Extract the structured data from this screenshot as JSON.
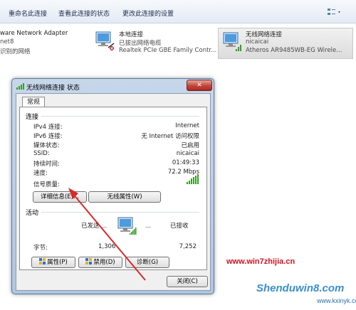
{
  "toolbar": {
    "rename": "重命名此连接",
    "view_status": "查看此连接的状态",
    "change_settings": "更改此连接的设置"
  },
  "adapters": [
    {
      "name": "ware Network Adapter",
      "status": "net8",
      "device": "识别的网络"
    },
    {
      "name": "本地连接",
      "status": "已拔出网络电缆",
      "device": "Realtek PCIe GBE Family Contr..."
    },
    {
      "name": "无线网络连接",
      "status": "nicaicai",
      "device": "Atheros AR9485WB-EG Wirele..."
    }
  ],
  "dialog": {
    "title": "无线网络连接 状态",
    "close_glyph": "✕",
    "tab": "常规",
    "connection_section": "连接",
    "rows": [
      {
        "label": "IPv4 连接:",
        "value": "Internet"
      },
      {
        "label": "IPv6 连接:",
        "value": "无 Internet 访问权限"
      },
      {
        "label": "媒体状态:",
        "value": "已启用"
      },
      {
        "label": "SSID:",
        "value": "nicaicai"
      },
      {
        "label": "持续时间:",
        "value": "01:49:33"
      },
      {
        "label": "速度:",
        "value": "72.2 Mbps"
      }
    ],
    "signal_label": "信号质量:",
    "details_button": "详细信息(E)...",
    "wireless_props_button": "无线属性(W)",
    "activity_section": "活动",
    "sent_label": "已发送",
    "received_label": "已接收",
    "bytes_label": "字节:",
    "bytes_sent": "1,306",
    "bytes_received": "7,252",
    "properties_button": "属性(P)",
    "disable_button": "禁用(D)",
    "diagnose_button": "诊断(G)",
    "close_button": "关闭(C)"
  },
  "watermark": {
    "site1": "www.win7zhijia.cn",
    "site2": "Shenduwin8.com",
    "site3": "www.kxinyk.com"
  },
  "colors": {
    "signal": "#3a9a2a",
    "arrow": "#d62b2b",
    "close_red": "#c1453a"
  }
}
